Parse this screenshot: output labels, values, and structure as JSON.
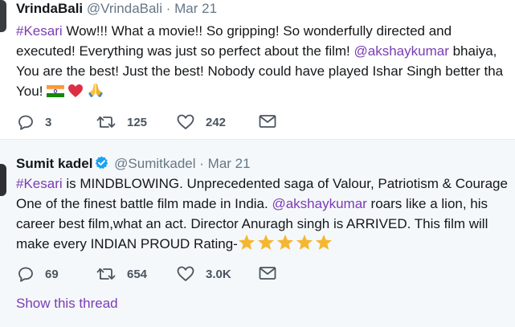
{
  "tweets": [
    {
      "name": "VrindaBali",
      "handle": "@VrindaBali",
      "separator": "·",
      "date": "Mar 21",
      "text": {
        "l1_tag": "#Kesari",
        "l1_rest": " Wow!!! What a movie!! So gripping! So wonderfully directed and",
        "l2": "executed! Everything was just so perfect about the film! ",
        "l2_mention": "@akshaykumar",
        "l2_end": " bhaiya,",
        "l3": "You are the best! Just the best! Nobody could have played Ishar Singh better tha",
        "l4": "You! "
      },
      "emojis": [
        "india-flag-emoji",
        "red-heart-emoji",
        "folded-hands-emoji"
      ],
      "replies": "3",
      "retweets": "125",
      "likes": "242"
    },
    {
      "name": "Sumit kadel",
      "handle": "@Sumitkadel",
      "separator": "·",
      "date": "Mar 21",
      "text": {
        "l1_tag": "#Kesari",
        "l1_rest": " is MINDBLOWING. Unprecedented saga of Valour, Patriotism & Courage",
        "l2": "One of the finest battle film made in India. ",
        "l2_mention": "@akshaykumar",
        "l2_end": " roars like a lion, his",
        "l3": "career best film,what an act. Director Anuragh singh is ARRIVED. This film will",
        "l4": "make every INDIAN PROUD Rating-"
      },
      "rating_stars": 5,
      "replies": "69",
      "retweets": "654",
      "likes": "3.0K",
      "show_thread": "Show this thread"
    }
  ],
  "colors": {
    "link": "#7a3cb5",
    "text": "#14171a",
    "muted": "#657786",
    "verified": "#1da1f2",
    "star": "#f5b731"
  }
}
